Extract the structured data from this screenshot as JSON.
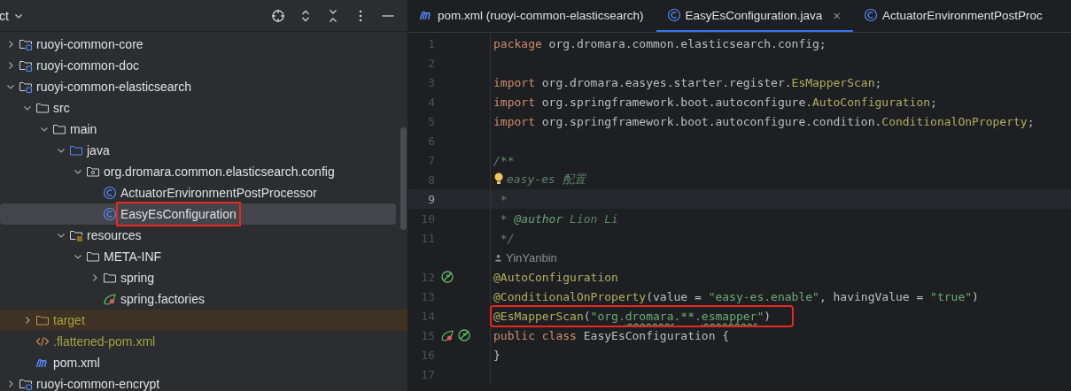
{
  "project_panel": {
    "title": "ct",
    "tree": [
      {
        "label": "ruoyi-common-core",
        "kind": "module",
        "expanded": false,
        "selected": false,
        "ignored": false,
        "highlighted": false
      },
      {
        "label": "ruoyi-common-doc",
        "kind": "module",
        "expanded": false,
        "selected": false,
        "ignored": false,
        "highlighted": false
      },
      {
        "label": "ruoyi-common-elasticsearch",
        "kind": "module",
        "expanded": true,
        "selected": false,
        "ignored": false,
        "highlighted": false,
        "children": [
          {
            "label": "src",
            "kind": "folder",
            "expanded": true,
            "selected": false,
            "ignored": false,
            "highlighted": false,
            "children": [
              {
                "label": "main",
                "kind": "folder",
                "expanded": true,
                "selected": false,
                "ignored": false,
                "highlighted": false,
                "children": [
                  {
                    "label": "java",
                    "kind": "source-folder",
                    "expanded": true,
                    "selected": false,
                    "ignored": false,
                    "highlighted": false,
                    "children": [
                      {
                        "label": "org.dromara.common.elasticsearch.config",
                        "kind": "package",
                        "expanded": true,
                        "selected": false,
                        "ignored": false,
                        "highlighted": false,
                        "children": [
                          {
                            "label": "ActuatorEnvironmentPostProcessor",
                            "kind": "class",
                            "selected": false,
                            "ignored": false,
                            "highlighted": false
                          },
                          {
                            "label": "EasyEsConfiguration",
                            "kind": "class",
                            "selected": true,
                            "ignored": false,
                            "highlighted": true
                          }
                        ]
                      }
                    ]
                  },
                  {
                    "label": "resources",
                    "kind": "resources",
                    "expanded": true,
                    "selected": false,
                    "ignored": false,
                    "highlighted": false,
                    "children": [
                      {
                        "label": "META-INF",
                        "kind": "folder",
                        "expanded": true,
                        "selected": false,
                        "ignored": false,
                        "highlighted": false,
                        "children": [
                          {
                            "label": "spring",
                            "kind": "folder",
                            "expanded": false,
                            "selected": false,
                            "ignored": false,
                            "highlighted": false
                          },
                          {
                            "label": "spring.factories",
                            "kind": "spring",
                            "selected": false,
                            "ignored": false,
                            "highlighted": false
                          }
                        ]
                      }
                    ]
                  }
                ]
              }
            ]
          },
          {
            "label": "target",
            "kind": "excluded-folder",
            "expanded": false,
            "selected": false,
            "ignored": true,
            "highlighted": false
          },
          {
            "label": ".flattened-pom.xml",
            "kind": "xml",
            "selected": false,
            "ignored": true,
            "highlighted": false
          },
          {
            "label": "pom.xml",
            "kind": "maven",
            "selected": false,
            "ignored": false,
            "highlighted": false
          }
        ]
      },
      {
        "label": "ruoyi-common-encrypt",
        "kind": "module",
        "expanded": false,
        "selected": false,
        "ignored": false,
        "highlighted": false
      }
    ]
  },
  "tabs": [
    {
      "label": "pom.xml (ruoyi-common-elasticsearch)",
      "kind": "maven",
      "selected": false
    },
    {
      "label": "EasyEsConfiguration.java",
      "kind": "class",
      "selected": true,
      "close": "×"
    },
    {
      "label": "ActuatorEnvironmentPostProc",
      "kind": "class",
      "selected": false
    }
  ],
  "code": [
    {
      "number": "1",
      "current": false,
      "tokens": [
        {
          "kind": "keyword",
          "text": "package"
        },
        {
          "kind": "plain",
          "text": " org.dromara.common.elasticsearch.config;"
        }
      ]
    },
    {
      "number": "2",
      "current": false
    },
    {
      "number": "3",
      "current": false,
      "tokens": [
        {
          "kind": "keyword",
          "text": "import"
        },
        {
          "kind": "plain",
          "text": " org.dromara.easyes.starter.register."
        },
        {
          "kind": "annotation",
          "text": "EsMapperScan"
        },
        {
          "kind": "plain",
          "text": ";"
        }
      ]
    },
    {
      "number": "4",
      "current": false,
      "tokens": [
        {
          "kind": "keyword",
          "text": "import"
        },
        {
          "kind": "plain",
          "text": " org.springframework.boot.autoconfigure."
        },
        {
          "kind": "annotation",
          "text": "AutoConfiguration"
        },
        {
          "kind": "plain",
          "text": ";"
        }
      ]
    },
    {
      "number": "5",
      "current": false,
      "tokens": [
        {
          "kind": "keyword",
          "text": "import"
        },
        {
          "kind": "plain",
          "text": " org.springframework.boot.autoconfigure.condition."
        },
        {
          "kind": "annotation",
          "text": "ConditionalOnProperty"
        },
        {
          "kind": "plain",
          "text": ";"
        }
      ]
    },
    {
      "number": "6",
      "current": false
    },
    {
      "number": "7",
      "current": false,
      "tokens": [
        {
          "kind": "doc",
          "text": "/**"
        }
      ]
    },
    {
      "number": "8",
      "current": false,
      "intention": true,
      "tokens": [
        {
          "kind": "doc",
          "text": "easy-es 配置"
        }
      ]
    },
    {
      "number": "9",
      "current": true,
      "tokens": [
        {
          "kind": "doc",
          "text": " *"
        }
      ]
    },
    {
      "number": "10",
      "current": false,
      "tokens": [
        {
          "kind": "doc",
          "text": " * "
        },
        {
          "kind": "doc-tag",
          "text": "@author"
        },
        {
          "kind": "doc",
          "text": " Lion Li"
        }
      ]
    },
    {
      "number": "11",
      "current": false,
      "tokens": [
        {
          "kind": "doc",
          "text": " */"
        }
      ]
    },
    {
      "kind": "author-hint",
      "text": "YinYanbin"
    },
    {
      "number": "12",
      "current": false,
      "gutter_icons": [
        {
          "kind": "bean"
        }
      ],
      "tokens": [
        {
          "kind": "annotation",
          "text": "@AutoConfiguration"
        }
      ]
    },
    {
      "number": "13",
      "current": false,
      "tokens": [
        {
          "kind": "annotation",
          "text": "@ConditionalOnProperty"
        },
        {
          "kind": "plain",
          "text": "(value = "
        },
        {
          "kind": "string",
          "text": "\"easy-es.enable\""
        },
        {
          "kind": "plain",
          "text": ", havingValue = "
        },
        {
          "kind": "string",
          "text": "\"true\""
        },
        {
          "kind": "plain",
          "text": ")"
        }
      ]
    },
    {
      "number": "14",
      "current": false,
      "highlighted": true,
      "tokens": [
        {
          "kind": "annotation",
          "text": "@EsMapperScan"
        },
        {
          "kind": "plain",
          "text": "("
        },
        {
          "kind": "string",
          "text": "\"org."
        },
        {
          "kind": "string",
          "text": "dromara",
          "typo": true
        },
        {
          "kind": "string",
          "text": ".**."
        },
        {
          "kind": "string",
          "text": "esmapper",
          "typo": true
        },
        {
          "kind": "string",
          "text": "\""
        },
        {
          "kind": "plain",
          "text": ")"
        }
      ]
    },
    {
      "number": "15",
      "current": false,
      "gutter_icons": [
        {
          "kind": "spring"
        },
        {
          "kind": "bean"
        }
      ],
      "tokens": [
        {
          "kind": "keyword",
          "text": "public class"
        },
        {
          "kind": "plain",
          "text": " EasyEsConfiguration {"
        }
      ]
    },
    {
      "number": "16",
      "current": false,
      "tokens": [
        {
          "kind": "plain",
          "text": "}"
        }
      ]
    },
    {
      "number": "17",
      "current": false
    }
  ]
}
